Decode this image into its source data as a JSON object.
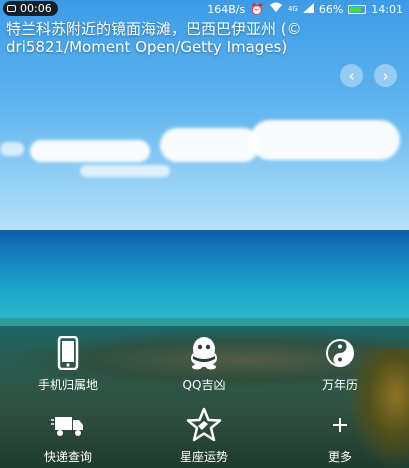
{
  "status_bar": {
    "time": "00:06",
    "speed": "164B/s",
    "network": "4G",
    "battery_percent": "66%",
    "clock": "14:01"
  },
  "caption": "特兰科苏附近的镜面海滩，巴西巴伊亚州 (© dri5821/Moment Open/Getty Images)",
  "nav": {
    "prev_icon": "chevron-left-icon",
    "next_icon": "chevron-right-icon"
  },
  "tiles": [
    {
      "label": "手机归属地",
      "icon": "phone-icon"
    },
    {
      "label": "QQ吉凶",
      "icon": "qq-penguin-icon"
    },
    {
      "label": "万年历",
      "icon": "yin-yang-icon"
    },
    {
      "label": "快递查询",
      "icon": "delivery-truck-icon"
    },
    {
      "label": "星座运势",
      "icon": "star-icon"
    },
    {
      "label": "更多",
      "icon": "plus-icon"
    }
  ]
}
